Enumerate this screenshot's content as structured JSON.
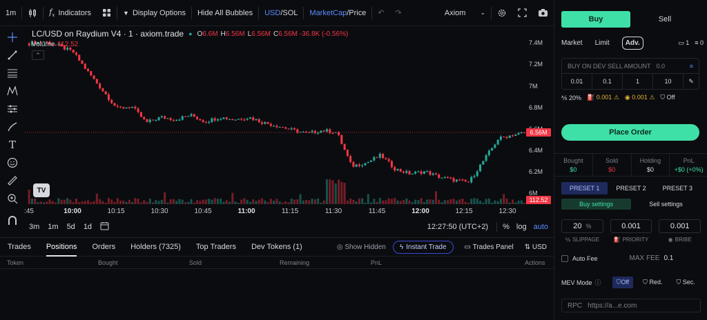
{
  "toolbar": {
    "interval": "1m",
    "indicators": "Indicators",
    "display_options": "Display Options",
    "hide_bubbles": "Hide All Bubbles",
    "currency_usd": "USD",
    "currency_sep": "/",
    "currency_sol": "SOL",
    "metric_mc": "MarketCap",
    "metric_sep": "/",
    "metric_price": "Price",
    "brand": "Axiom"
  },
  "chart": {
    "symbol": "LC/USD on Raydium V4 · 1 · axiom.trade",
    "ohlc": [
      {
        "k": "O",
        "v": "6.6M"
      },
      {
        "k": "H",
        "v": "6.56M"
      },
      {
        "k": "L",
        "v": "6.56M"
      },
      {
        "k": "C",
        "v": "6.56M -36.8K (-0.56%)"
      }
    ],
    "volume_label": "Volume",
    "volume_value": "112.52",
    "price_ticks": [
      "7.4M",
      "7.2M",
      "7M",
      "6.8M",
      "6.6M",
      "6.4M",
      "6.2M",
      "6M"
    ],
    "last_price_tag": "6.56M",
    "volume_tag": "112.52",
    "time_ticks": [
      ":45",
      "10:00",
      "10:15",
      "10:30",
      "10:45",
      "11:00",
      "11:15",
      "11:30",
      "11:45",
      "12:00",
      "12:15",
      "12:30"
    ],
    "bold_time_ticks": [
      "10:00",
      "11:00",
      "12:00"
    ],
    "ranges": [
      "3m",
      "1m",
      "5d",
      "1d"
    ],
    "clock": "12:27:50 (UTC+2)",
    "percent": "%",
    "log": "log",
    "auto": "auto",
    "colors": {
      "up": "#26a69a",
      "down": "#f23645"
    }
  },
  "chart_data": {
    "type": "candlestick",
    "x": [
      "09:43",
      "09:48",
      "09:53",
      "09:58",
      "10:03",
      "10:08",
      "10:13",
      "10:18",
      "10:23",
      "10:28",
      "10:33",
      "10:38",
      "10:43",
      "10:48",
      "10:53",
      "10:58",
      "11:03",
      "11:08",
      "11:13",
      "11:18",
      "11:23",
      "11:28",
      "11:31",
      "11:33",
      "11:38",
      "11:43",
      "11:48",
      "11:53",
      "11:58",
      "12:03",
      "12:08",
      "12:13",
      "12:18",
      "12:23",
      "12:27"
    ],
    "close": [
      7.38,
      7.4,
      7.36,
      7.3,
      7.12,
      6.95,
      6.78,
      6.8,
      6.65,
      6.7,
      6.68,
      6.72,
      6.66,
      6.7,
      6.68,
      6.7,
      6.65,
      6.62,
      6.58,
      6.55,
      6.58,
      6.56,
      6.25,
      6.28,
      6.35,
      6.22,
      6.18,
      6.2,
      6.15,
      6.12,
      6.1,
      6.3,
      6.5,
      6.54,
      6.56
    ],
    "ylim": [
      5.95,
      7.45
    ]
  },
  "tabs": {
    "items": [
      "Trades",
      "Positions",
      "Orders",
      "Holders (7325)",
      "Top Traders",
      "Dev Tokens (1)"
    ],
    "show_hidden": "Show Hidden",
    "instant_trade": "Instant Trade",
    "trades_panel": "Trades Panel",
    "currency": "USD"
  },
  "table_headers": [
    "Token",
    "Bought",
    "Sold",
    "Remaining",
    "PnL",
    "Actions"
  ],
  "panel": {
    "buy": "Buy",
    "sell": "Sell",
    "order_types": [
      "Market",
      "Limit"
    ],
    "adv": "Adv.",
    "count_a": "1",
    "count_b": "0",
    "dev_sell_label": "BUY ON DEV SELL AMOUNT",
    "dev_sell_value": "0.0",
    "amounts": [
      "0.01",
      "0.1",
      "1",
      "10"
    ],
    "slippage_flag": "20%",
    "priority_flag": "0.001",
    "bribe_flag": "0.001",
    "mev_flag": "Off",
    "place_order": "Place Order",
    "stats": [
      {
        "label": "Bought",
        "value": "$0",
        "cls": "green"
      },
      {
        "label": "Sold",
        "value": "$0",
        "cls": "red"
      },
      {
        "label": "Holding",
        "value": "$0",
        "cls": ""
      },
      {
        "label": "PnL",
        "value": "+$0 (+0%)",
        "cls": "green"
      }
    ],
    "presets": [
      "PRESET 1",
      "PRESET 2",
      "PRESET 3"
    ],
    "buy_settings": "Buy settings",
    "sell_settings": "Sell settings",
    "slippage_value": "20",
    "slippage_unit": "%",
    "slippage_label": "SLIPPAGE",
    "priority_value": "0.001",
    "priority_label": "PRIORITY",
    "bribe_value": "0.001",
    "bribe_label": "BRIBE",
    "auto_fee": "Auto Fee",
    "max_fee_label": "MAX FEE",
    "max_fee_value": "0.1",
    "mev_label": "MEV Mode",
    "mev_options": [
      "Off",
      "Red.",
      "Sec."
    ],
    "rpc_label": "RPC",
    "rpc_value": "https://a...e.com"
  }
}
